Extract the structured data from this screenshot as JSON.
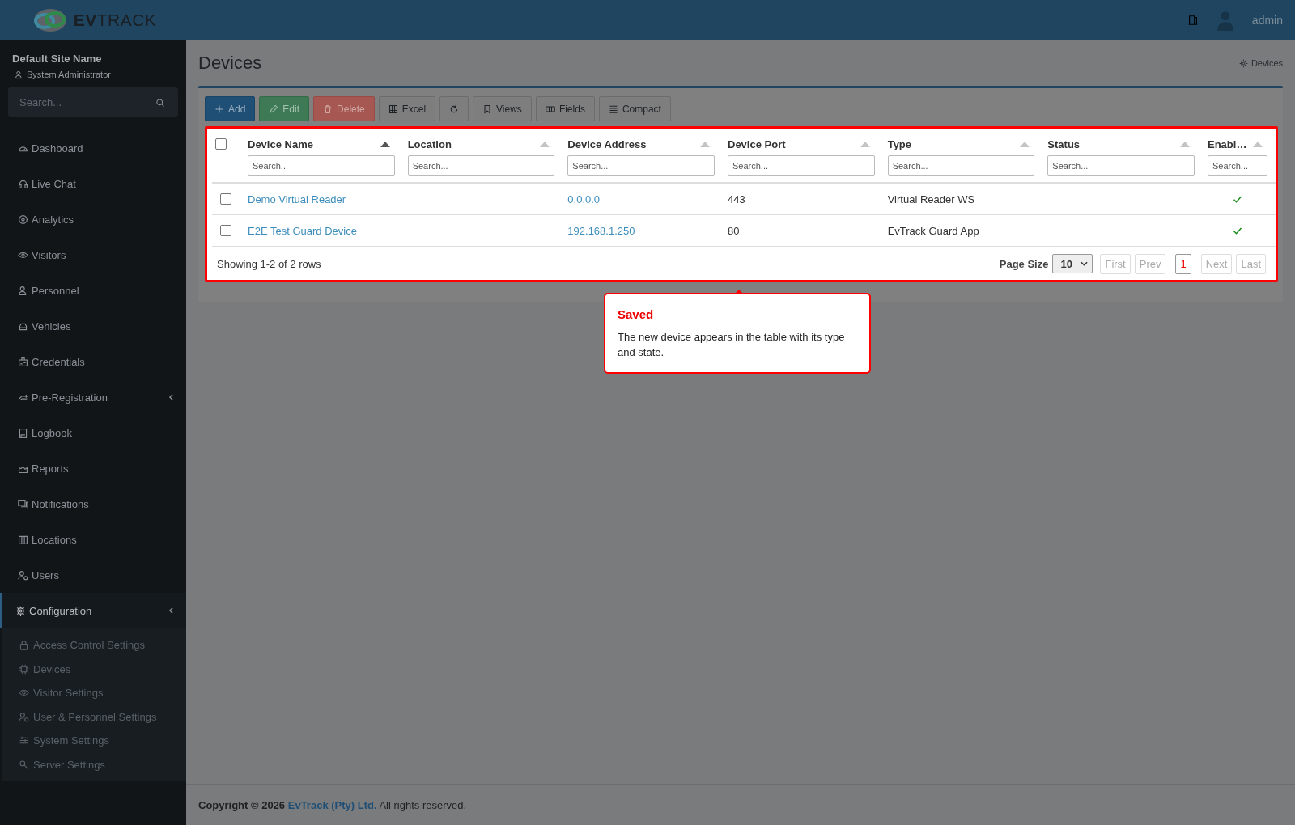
{
  "brand": {
    "logo": "**EV**TRACK"
  },
  "header": {
    "user": "admin"
  },
  "sidebar": {
    "site_name": "Default Site Name",
    "role": "System Administrator",
    "search": {
      "placeholder": "Search..."
    },
    "items": [
      {
        "label": "Dashboard",
        "selected": false
      },
      {
        "label": "Live Chat",
        "selected": false
      },
      {
        "label": "Analytics",
        "selected": false
      },
      {
        "label": "Visitors",
        "selected": false
      },
      {
        "label": "Personnel",
        "selected": false
      },
      {
        "label": "Vehicles",
        "selected": false
      },
      {
        "label": "Credentials",
        "selected": false
      },
      {
        "label": "Pre-Registration",
        "selected": false,
        "expandable": true
      },
      {
        "label": "Logbook",
        "selected": false
      },
      {
        "label": "Reports",
        "selected": false
      },
      {
        "label": "Notifications",
        "selected": false
      },
      {
        "label": "Locations",
        "selected": false
      },
      {
        "label": "Users",
        "selected": false
      },
      {
        "label": "Configuration",
        "selected": true,
        "expandable": true,
        "children": [
          {
            "label": "Access Control Settings"
          },
          {
            "label": "Devices"
          },
          {
            "label": "Visitor Settings"
          },
          {
            "label": "User & Personnel Settings"
          },
          {
            "label": "System Settings"
          },
          {
            "label": "Server Settings"
          }
        ]
      }
    ]
  },
  "page": {
    "title": "Devices",
    "breadcrumb": "Devices"
  },
  "toolbar": [
    {
      "label": "Add",
      "kind": "primary",
      "disabled": false
    },
    {
      "label": "Edit",
      "kind": "success",
      "disabled": true
    },
    {
      "label": "Delete",
      "kind": "danger",
      "disabled": true
    },
    {
      "label": "Excel",
      "kind": "default",
      "disabled": false
    },
    {
      "kind": "default",
      "disabled": false
    },
    {
      "label": "Views",
      "kind": "default",
      "disabled": false
    },
    {
      "label": "Fields",
      "kind": "default",
      "disabled": false
    },
    {
      "label": "Compact",
      "kind": "default",
      "disabled": false
    }
  ],
  "table": {
    "select_all": {
      "checked": false
    },
    "columns": [
      {
        "label": "Device Name",
        "sorted": true,
        "placeholder": "Search..."
      },
      {
        "label": "Location",
        "sorted": false,
        "placeholder": "Search..."
      },
      {
        "label": "Device Address",
        "sorted": false,
        "placeholder": "Search..."
      },
      {
        "label": "Device Port",
        "sorted": false,
        "placeholder": "Search..."
      },
      {
        "label": "Type",
        "sorted": false,
        "placeholder": "Search..."
      },
      {
        "label": "Status",
        "sorted": false,
        "placeholder": "Search..."
      },
      {
        "label": "Enabl…",
        "sorted": false,
        "placeholder": "Search..."
      }
    ],
    "rows": [
      {
        "checked": false,
        "device_name": "Demo Virtual Reader",
        "device_address": "0.0.0.0",
        "device_port": "443",
        "type": "Virtual Reader WS",
        "enabled": true
      },
      {
        "checked": false,
        "device_name": "E2E Test Guard Device",
        "device_address": "192.168.1.250",
        "device_port": "80",
        "type": "EvTrack Guard App",
        "enabled": true
      }
    ],
    "summary": "Showing 1-2 of 2 rows",
    "page_size_label": "Page Size",
    "page_size": "10",
    "pages": [
      {
        "label": "First",
        "disabled": true,
        "selected": false
      },
      {
        "label": "Prev",
        "disabled": true,
        "selected": false
      },
      {
        "label": "1",
        "disabled": false,
        "selected": true
      },
      {
        "label": "Next",
        "disabled": true,
        "selected": false
      },
      {
        "label": "Last",
        "disabled": true,
        "selected": false
      }
    ]
  },
  "callout": {
    "title": "Saved",
    "text": "The new device appears in the table with its type and state."
  },
  "footer": {
    "prefix": "Copyright © 2026",
    "company": "EvTrack (Pty) Ltd.",
    "suffix": "All rights reserved."
  }
}
